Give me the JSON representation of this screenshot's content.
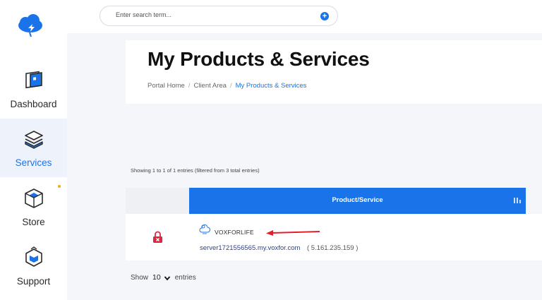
{
  "sidebar": {
    "items": [
      {
        "label": "Dashboard",
        "icon": "dashboard-icon"
      },
      {
        "label": "Services",
        "icon": "services-icon",
        "active": true
      },
      {
        "label": "Store",
        "icon": "store-icon",
        "badge_color": "#f0a81b"
      },
      {
        "label": "Support",
        "icon": "support-icon"
      }
    ]
  },
  "header": {
    "search_placeholder": "Enter search term...",
    "search_button_icon": "plus-circle-icon"
  },
  "page": {
    "title": "My Products & Services",
    "breadcrumb": [
      "Portal Home",
      "Client Area",
      "My Products & Services"
    ]
  },
  "table": {
    "info": "Showing 1 to 1 of 1 entries (filtered from 3 total entries)",
    "column_header": "Product/Service",
    "rows": [
      {
        "status_icon": "suspended-status-icon",
        "name": "VOXFORLIFE",
        "domain": "server1721556565.my.voxfor.com",
        "ip": "( 5.161.235.159 )"
      }
    ]
  },
  "pagination": {
    "show_label": "Show",
    "page_size": "10",
    "entries_label": "entries"
  },
  "colors": {
    "accent": "#1a73e8",
    "active_bg": "#eef3fb",
    "status_red": "#e0263c",
    "arrow_red": "#e0202a"
  }
}
